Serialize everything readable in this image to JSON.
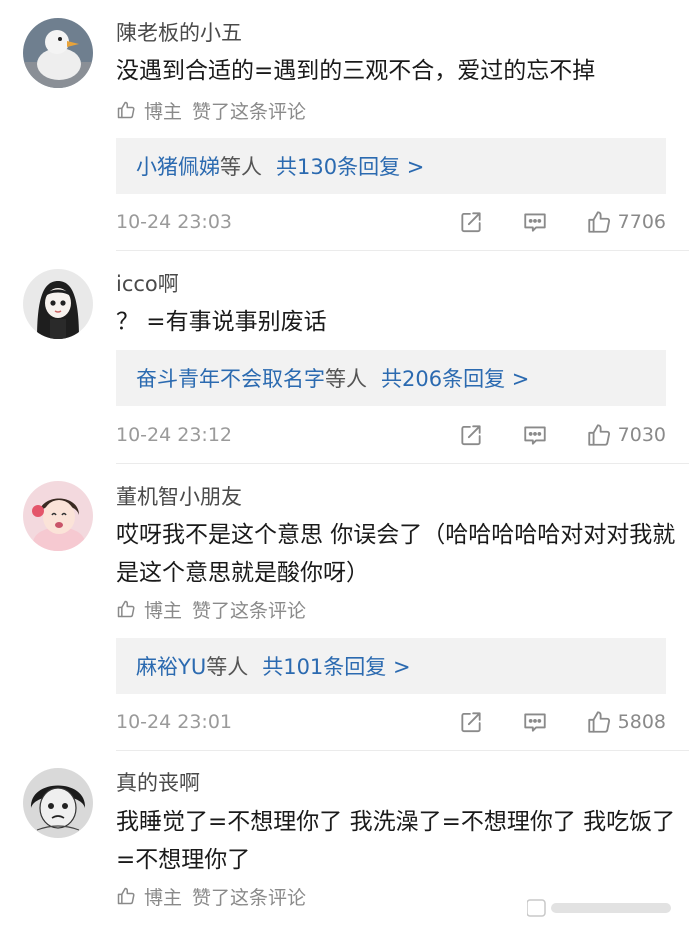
{
  "common": {
    "blogger_label": "博主",
    "liked_label": "赞了这条评论"
  },
  "comments": [
    {
      "username": "陳老板的小五",
      "content": "没遇到合适的=遇到的三观不合，爱过的忘不掉",
      "reply_names": "小猪佩娣",
      "reply_etc": "等人",
      "reply_count": "共130条回复 >",
      "time": "10-24 23:03",
      "likes": "7706"
    },
    {
      "username": "icco啊",
      "content": "？ =有事说事别废话",
      "reply_names": "奋斗青年不会取名字",
      "reply_etc": "等人",
      "reply_count": "共206条回复 >",
      "time": "10-24 23:12",
      "likes": "7030"
    },
    {
      "username": "董机智小朋友",
      "content": "哎呀我不是这个意思 你误会了（哈哈哈哈哈对对对我就是这个意思就是酸你呀）",
      "reply_names": "麻裕YU",
      "reply_etc": "等人",
      "reply_count": "共101条回复 >",
      "time": "10-24 23:01",
      "likes": "5808"
    },
    {
      "username": "真的丧啊",
      "content": "我睡觉了=不想理你了 我洗澡了=不想理你了 我吃饭了=不想理你了"
    }
  ],
  "icons": {
    "thumb": "thumb-up-icon",
    "share": "share-icon",
    "comment": "comment-icon",
    "watermark": "watermark-icon"
  },
  "colors": {
    "link": "#2b6ab0",
    "reply_bg": "#f2f2f2",
    "meta": "#9a9a9a"
  }
}
